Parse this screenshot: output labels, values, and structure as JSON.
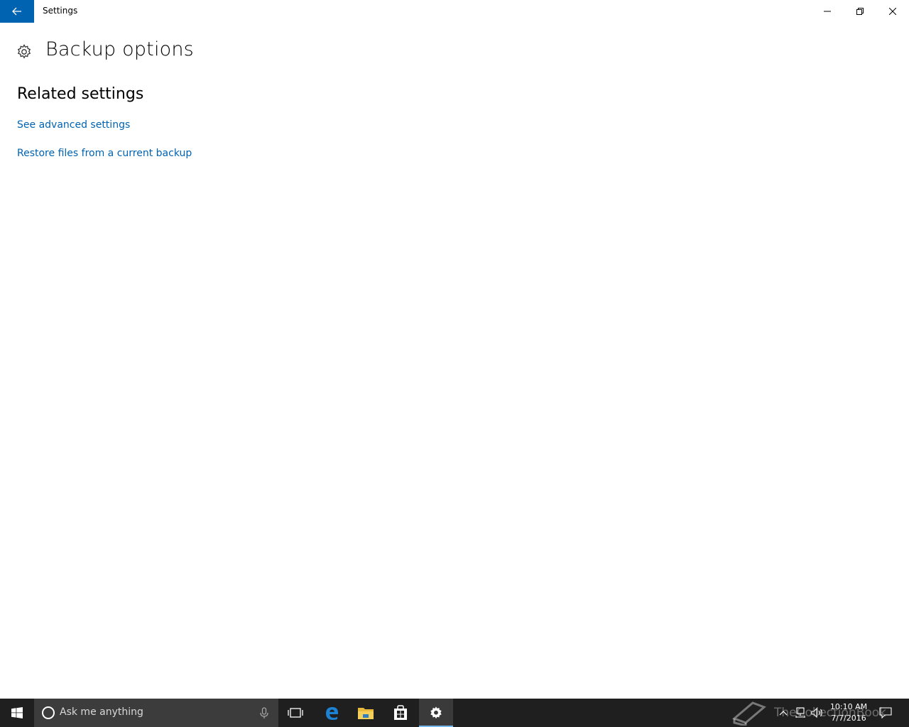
{
  "window": {
    "title": "Settings"
  },
  "page": {
    "title": "Backup options",
    "section_title": "Related settings",
    "links": [
      {
        "label": "See advanced settings"
      },
      {
        "label": "Restore files from a current backup"
      }
    ]
  },
  "taskbar": {
    "search_placeholder": "Ask me anything",
    "clock_time": "10:10 AM",
    "clock_date": "7/7/2016",
    "watermark": "TheCollectionBook",
    "pinned_apps": [
      "task-view-icon",
      "edge-icon",
      "file-explorer-icon",
      "store-icon",
      "settings-icon"
    ]
  },
  "colors": {
    "accent": "#0063b1",
    "link": "#0063b1",
    "taskbar": "#1f1f1f",
    "search_box": "#3c3c3c"
  }
}
